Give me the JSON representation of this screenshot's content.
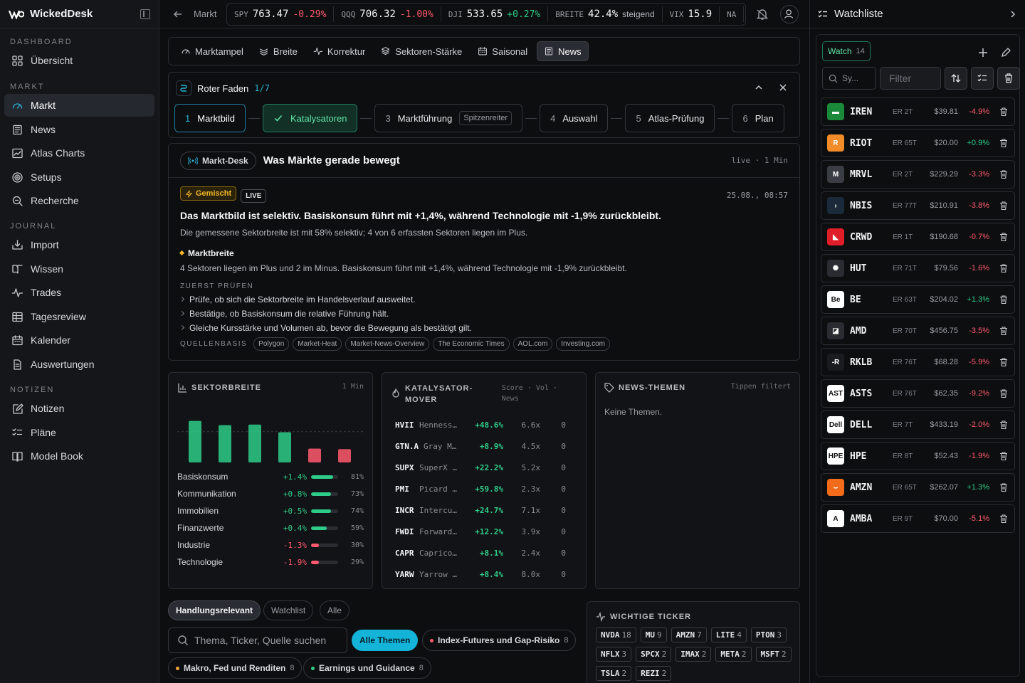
{
  "app": {
    "name": "WickedDesk"
  },
  "sidebar": {
    "sections": [
      {
        "label": "DASHBOARD",
        "items": [
          {
            "label": "Übersicht",
            "icon": "grid-icon"
          }
        ]
      },
      {
        "label": "MARKT",
        "items": [
          {
            "label": "Markt",
            "icon": "gauge-icon",
            "active": true
          },
          {
            "label": "News",
            "icon": "newspaper-icon"
          },
          {
            "label": "Atlas Charts",
            "icon": "chart-icon"
          },
          {
            "label": "Setups",
            "icon": "target-icon"
          },
          {
            "label": "Recherche",
            "icon": "search-icon"
          }
        ]
      },
      {
        "label": "JOURNAL",
        "items": [
          {
            "label": "Import",
            "icon": "import-icon"
          },
          {
            "label": "Wissen",
            "icon": "book-open-icon"
          },
          {
            "label": "Trades",
            "icon": "pulse-icon"
          },
          {
            "label": "Tagesreview",
            "icon": "table-icon"
          },
          {
            "label": "Kalender",
            "icon": "calendar-icon"
          },
          {
            "label": "Auswertungen",
            "icon": "report-icon"
          }
        ]
      },
      {
        "label": "NOTIZEN",
        "items": [
          {
            "label": "Notizen",
            "icon": "note-edit-icon"
          },
          {
            "label": "Pläne",
            "icon": "checklist-icon"
          },
          {
            "label": "Model Book",
            "icon": "book-icon"
          }
        ]
      }
    ]
  },
  "topbar": {
    "breadcrumb": "Markt",
    "tickers": [
      {
        "sym": "SPY",
        "val": "763.47",
        "chg": "-0.29%",
        "dir": "neg"
      },
      {
        "sym": "QQQ",
        "val": "706.32",
        "chg": "-1.00%",
        "dir": "neg"
      },
      {
        "sym": "DJI",
        "val": "533.65",
        "chg": "+0.27%",
        "dir": "pos"
      },
      {
        "sym": "BREITE",
        "val": "42.4%",
        "chg": "steigend",
        "dir": "muted"
      },
      {
        "sym": "VIX",
        "val": "15.9",
        "chg": "",
        "dir": "muted"
      },
      {
        "sym": "NA",
        "val": "",
        "chg": "",
        "dir": "muted"
      }
    ]
  },
  "tabs": [
    {
      "label": "Marktampel",
      "icon": "gauge-icon"
    },
    {
      "label": "Breite",
      "icon": "layers-icon"
    },
    {
      "label": "Korrektur",
      "icon": "pulse-icon"
    },
    {
      "label": "Sektoren-Stärke",
      "icon": "stack-icon"
    },
    {
      "label": "Saisonal",
      "icon": "calendar-icon"
    },
    {
      "label": "News",
      "icon": "newspaper-icon",
      "active": true
    }
  ],
  "roter_faden": {
    "title": "Roter Faden",
    "count": "1/7",
    "steps": [
      {
        "n": "1",
        "label": "Marktbild",
        "state": "current"
      },
      {
        "n": "",
        "label": "Katalysatoren",
        "state": "done"
      },
      {
        "n": "3",
        "label": "Marktführung",
        "tag": "Spitzenreiter"
      },
      {
        "n": "4",
        "label": "Auswahl"
      },
      {
        "n": "5",
        "label": "Atlas-Prüfung"
      },
      {
        "n": "6",
        "label": "Plan"
      }
    ]
  },
  "desk": {
    "chip": "Markt-Desk",
    "title": "Was Märkte gerade bewegt",
    "meta": "live · 1 Min",
    "badge": "Gemischt",
    "live": "LIVE",
    "date": "25.08., 08:57",
    "headline": "Das Marktbild ist selektiv. Basiskonsum führt mit +1,4%, während Technologie mit -1,9% zurückbleibt.",
    "sub": "Die gemessene Sektorbreite ist mit 58% selektiv; 4 von 6 erfassten Sektoren liegen im Plus.",
    "bullet_title": "Marktbreite",
    "bullet_text": "4 Sektoren liegen im Plus und 2 im Minus. Basiskonsum führt mit +1,4%, während Technologie mit -1,9% zurückbleibt.",
    "check_title": "ZUERST PRÜFEN",
    "checks": [
      "Prüfe, ob sich die Sektorbreite im Handelsverlauf ausweitet.",
      "Bestätige, ob Basiskonsum die relative Führung hält.",
      "Gleiche Kursstärke und Volumen ab, bevor die Bewegung als bestätigt gilt."
    ],
    "sources_label": "QUELLENBASIS",
    "sources": [
      "Polygon",
      "Market-Heat",
      "Market-News-Overview",
      "The Economic Times",
      "AOL.com",
      "Investing.com"
    ]
  },
  "sektorbreite": {
    "title": "SEKTORBREITE",
    "meta": "1 Min",
    "rows": [
      {
        "name": "Basiskonsum",
        "chg": "+1.4%",
        "pct": "81%",
        "value": 81,
        "dir": "pos"
      },
      {
        "name": "Kommunikation",
        "chg": "+0.8%",
        "pct": "73%",
        "value": 73,
        "dir": "pos"
      },
      {
        "name": "Immobilien",
        "chg": "+0.5%",
        "pct": "74%",
        "value": 74,
        "dir": "pos"
      },
      {
        "name": "Finanzwerte",
        "chg": "+0.4%",
        "pct": "59%",
        "value": 59,
        "dir": "pos"
      },
      {
        "name": "Industrie",
        "chg": "-1.3%",
        "pct": "30%",
        "value": 30,
        "dir": "neg"
      },
      {
        "name": "Technologie",
        "chg": "-1.9%",
        "pct": "29%",
        "value": 29,
        "dir": "neg"
      }
    ]
  },
  "katalysator": {
    "title1": "KATALYSATOR-",
    "title2": "MOVER",
    "cols1": "Score · Vol ·",
    "cols2": "News",
    "rows": [
      {
        "sym": "HVII",
        "name": "Henness...",
        "chg": "+48.6%",
        "vol": "6.6x",
        "news": "0"
      },
      {
        "sym": "GTN.A",
        "name": "Gray M...",
        "chg": "+8.9%",
        "vol": "4.5x",
        "news": "0"
      },
      {
        "sym": "SUPX",
        "name": "SuperX ...",
        "chg": "+22.2%",
        "vol": "5.2x",
        "news": "0"
      },
      {
        "sym": "PMI",
        "name": "Picard Me...",
        "chg": "+59.8%",
        "vol": "2.3x",
        "news": "0"
      },
      {
        "sym": "INCR",
        "name": "Intercure...",
        "chg": "+24.7%",
        "vol": "7.1x",
        "news": "0"
      },
      {
        "sym": "FWDI",
        "name": "Forward I...",
        "chg": "+12.2%",
        "vol": "3.9x",
        "news": "0"
      },
      {
        "sym": "CAPR",
        "name": "Capricor ...",
        "chg": "+8.1%",
        "vol": "2.4x",
        "news": "0"
      },
      {
        "sym": "YARW",
        "name": "Yarrow B...",
        "chg": "+8.4%",
        "vol": "8.0x",
        "news": "0"
      }
    ]
  },
  "themen": {
    "title": "NEWS-THEMEN",
    "meta": "Tippen filtert",
    "empty": "Keine Themen."
  },
  "filters": {
    "segments": [
      "Handlungsrelevant",
      "Watchlist",
      "Alle"
    ],
    "search_placeholder": "Thema, Ticker, Quelle suchen",
    "all_label": "Alle Themen",
    "pills": [
      {
        "label": "Index-Futures und Gap-Risiko",
        "count": "8",
        "color": "#ff5a6e"
      },
      {
        "label": "Makro, Fed und Renditen",
        "count": "8",
        "color": "#f2a23a"
      },
      {
        "label": "Earnings und Guidance",
        "count": "8",
        "color": "#2ecc88"
      }
    ]
  },
  "wichtige": {
    "title": "WICHTIGE TICKER",
    "items": [
      {
        "sym": "NVDA",
        "c": "18"
      },
      {
        "sym": "MU",
        "c": "9"
      },
      {
        "sym": "AMZN",
        "c": "7"
      },
      {
        "sym": "LITE",
        "c": "4"
      },
      {
        "sym": "PTON",
        "c": "3"
      },
      {
        "sym": "NFLX",
        "c": "3"
      },
      {
        "sym": "SPCX",
        "c": "2"
      },
      {
        "sym": "IMAX",
        "c": "2"
      },
      {
        "sym": "META",
        "c": "2"
      },
      {
        "sym": "MSFT",
        "c": "2"
      },
      {
        "sym": "TSLA",
        "c": "2"
      },
      {
        "sym": "REZI",
        "c": "2"
      }
    ]
  },
  "watchlist": {
    "title": "Watchliste",
    "tab": "Watch",
    "tab_count": "14",
    "sym_placeholder": "Sy...",
    "filter_placeholder": "Filter",
    "rows": [
      {
        "t": "IREN",
        "er": "ER 2T",
        "p": "$39.81",
        "c": "-4.9%",
        "dir": "neg",
        "logo": "#1a8a3a",
        "lt": "▬"
      },
      {
        "t": "RIOT",
        "er": "ER 65T",
        "p": "$20.00",
        "c": "+0.9%",
        "dir": "pos",
        "logo": "#f28c28",
        "lt": "R"
      },
      {
        "t": "MRVL",
        "er": "ER 2T",
        "p": "$229.29",
        "c": "-3.3%",
        "dir": "neg",
        "logo": "#3a3d43",
        "lt": "M"
      },
      {
        "t": "NBIS",
        "er": "ER 77T",
        "p": "$210.91",
        "c": "-3.8%",
        "dir": "neg",
        "logo": "#1b2a3a",
        "lt": "›"
      },
      {
        "t": "CRWD",
        "er": "ER 1T",
        "p": "$190.68",
        "c": "-0.7%",
        "dir": "neg",
        "logo": "#e01e2a",
        "lt": "◣"
      },
      {
        "t": "HUT",
        "er": "ER 71T",
        "p": "$79.56",
        "c": "-1.6%",
        "dir": "neg",
        "logo": "#2a2c31",
        "lt": "✺"
      },
      {
        "t": "BE",
        "er": "ER 63T",
        "p": "$204.02",
        "c": "+1.3%",
        "dir": "pos",
        "logo": "#ffffff",
        "lt": "Be"
      },
      {
        "t": "AMD",
        "er": "ER 70T",
        "p": "$456.75",
        "c": "-3.5%",
        "dir": "neg",
        "logo": "#2a2c31",
        "lt": "◪"
      },
      {
        "t": "RKLB",
        "er": "ER 76T",
        "p": "$68.28",
        "c": "-5.9%",
        "dir": "neg",
        "logo": "#1a1b1f",
        "lt": "-R"
      },
      {
        "t": "ASTS",
        "er": "ER 76T",
        "p": "$62.35",
        "c": "-9.2%",
        "dir": "neg",
        "logo": "#ffffff",
        "lt": "AST"
      },
      {
        "t": "DELL",
        "er": "ER 7T",
        "p": "$433.19",
        "c": "-2.0%",
        "dir": "neg",
        "logo": "#ffffff",
        "lt": "Dell"
      },
      {
        "t": "HPE",
        "er": "ER 8T",
        "p": "$52.43",
        "c": "-1.9%",
        "dir": "neg",
        "logo": "#ffffff",
        "lt": "HPE"
      },
      {
        "t": "AMZN",
        "er": "ER 65T",
        "p": "$262.07",
        "c": "+1.3%",
        "dir": "pos",
        "logo": "#f26b1a",
        "lt": "⌣"
      },
      {
        "t": "AMBA",
        "er": "ER 9T",
        "p": "$70.00",
        "c": "-5.1%",
        "dir": "neg",
        "logo": "#ffffff",
        "lt": "A"
      }
    ]
  },
  "colors": {
    "pos": "#2ecc88",
    "neg": "#ff5a6e",
    "accent": "#14b3d8",
    "gold": "#f2b928"
  }
}
